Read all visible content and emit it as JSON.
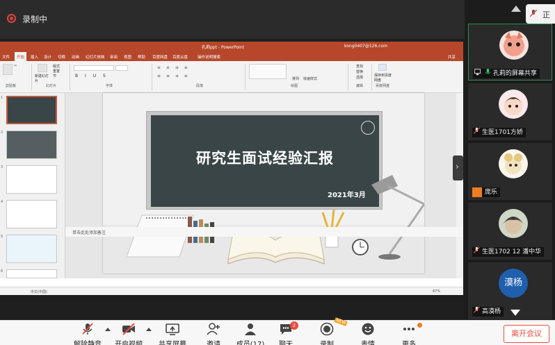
{
  "recording": {
    "label": "录制中"
  },
  "ppt": {
    "window_title": "孔莉ppt - PowerPoint",
    "account": "kong0407@126.com",
    "tabs": [
      "文件",
      "开始",
      "插入",
      "设计",
      "切换",
      "动画",
      "幻灯片放映",
      "审阅",
      "视图",
      "帮助",
      "百度网盘",
      "百度云盘",
      "操作说明搜索"
    ],
    "share_label": "共享",
    "ribbon_groups": [
      "剪贴板",
      "幻灯片",
      "字体",
      "段落",
      "绘图",
      "编辑",
      "百度网盘"
    ],
    "ribbon_items": {
      "new_slide": "新建幻灯片",
      "layout": "版式",
      "reset": "重置",
      "section": "节",
      "arrange": "排列",
      "quick_styles": "快速样式",
      "find": "查找",
      "replace": "替换",
      "select": "选择",
      "save_to_baidu": "保存到百度网盘"
    },
    "slide": {
      "title": "研究生面试经验汇报",
      "date": "2021年3月"
    },
    "notes_placeholder": "单击此处添加备注",
    "status": {
      "language": "中文(中国)",
      "zoom": "87%"
    },
    "thumb_numbers": [
      "1",
      "2",
      "3",
      "4",
      "5",
      "6"
    ]
  },
  "participants": [
    {
      "name": "孔莉的屏幕共享",
      "icon": "screen-share-icon",
      "active": true
    },
    {
      "name": "生医1701方娇",
      "icon": "mic-muted-icon",
      "active": false
    },
    {
      "name": "庞乐",
      "icon": "person-icon",
      "active": false
    },
    {
      "name": "生医1702 12 潘中华",
      "icon": "mic-muted-icon",
      "active": false
    },
    {
      "name": "高漠杨",
      "icon": "mic-muted-icon",
      "avatar_text": "漠杨",
      "active": false
    }
  ],
  "panel_edge_text": "正",
  "toolbar": {
    "unmute": "解除静音",
    "start_video": "开启视频",
    "share_screen": "共享屏幕",
    "invite": "邀请",
    "members": "成员(17)",
    "chat": "聊天",
    "chat_badge": "2",
    "record": "录制",
    "reactions": "表情",
    "more": "更多",
    "leave": "离开会议",
    "record_tag": "NEW"
  },
  "colors": {
    "ppt_accent": "#b7472a",
    "recording_red": "#e04343",
    "leave_red": "#e94c3d",
    "speaking_green": "#2e8b57"
  }
}
